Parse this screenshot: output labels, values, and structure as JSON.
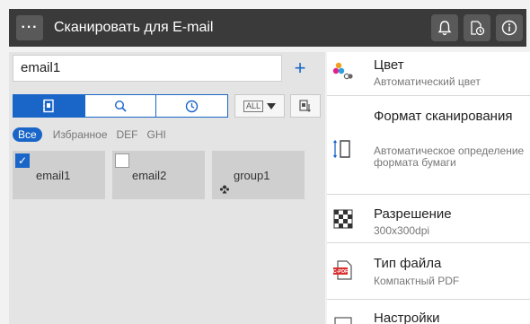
{
  "header": {
    "title": "Сканировать для E-mail",
    "menu_label": "···"
  },
  "address": {
    "value": "email1",
    "plus": "+"
  },
  "tools": {
    "all_label": "ALL"
  },
  "filters": [
    "Все",
    "Избранное",
    "DEF",
    "GHI"
  ],
  "destinations": [
    {
      "name": "email1",
      "checked": true
    },
    {
      "name": "email2",
      "checked": false
    },
    {
      "name": "group1",
      "checked": false
    }
  ],
  "settings": [
    {
      "label": "Цвет",
      "value": "Автоматический цвет"
    },
    {
      "label": "Формат сканирования",
      "value": "Автоматическое определение формата бумаги"
    },
    {
      "label": "Разрешение",
      "value": "300x300dpi"
    },
    {
      "label": "Тип файла",
      "value": "Компактный PDF",
      "badge": "C-PDF"
    },
    {
      "label": "Настройки"
    }
  ],
  "colors": {
    "accent": "#1a66c8",
    "titlebar": "#3a3a3a"
  }
}
